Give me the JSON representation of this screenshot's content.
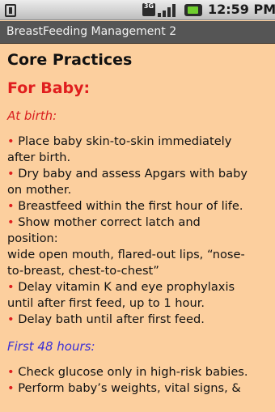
{
  "status": {
    "network_label": "3G",
    "time": "12:59 PM"
  },
  "app": {
    "title": "BreastFeeding Management 2"
  },
  "content": {
    "heading": "Core Practices",
    "subheading": "For Baby:",
    "section1_label": "At birth:",
    "section1_lines": [
      {
        "bullet": "•",
        "text": "Place baby skin-to-skin immediately"
      },
      {
        "bullet": "",
        "text": "after birth."
      },
      {
        "bullet": "•",
        "text": "Dry baby and assess Apgars with baby"
      },
      {
        "bullet": "",
        "text": "on mother."
      },
      {
        "bullet": "•",
        "text": "Breastfeed within the first hour of life."
      },
      {
        "bullet": "•",
        "text": "Show mother correct latch and"
      },
      {
        "bullet": "",
        "text": "position:"
      },
      {
        "bullet": "",
        "text": "wide open mouth, flared-out lips, “nose-"
      },
      {
        "bullet": "",
        "text": "to-breast, chest-to-chest”"
      },
      {
        "bullet": "•",
        "text": "Delay vitamin K and eye prophylaxis"
      },
      {
        "bullet": "",
        "text": "until after first feed, up to 1 hour."
      },
      {
        "bullet": "•",
        "text": "Delay bath until after first feed."
      }
    ],
    "section2_label": "First 48 hours:",
    "section2_lines": [
      {
        "bullet": "•",
        "text": "Check glucose only in high-risk babies."
      },
      {
        "bullet": "•",
        "text": "Perform baby’s weights, vital signs, &"
      }
    ]
  },
  "colors": {
    "background": "#fccf9e",
    "titlebar": "#555555",
    "accent_red": "#e01e1e",
    "accent_blue": "#3a2fd6"
  }
}
